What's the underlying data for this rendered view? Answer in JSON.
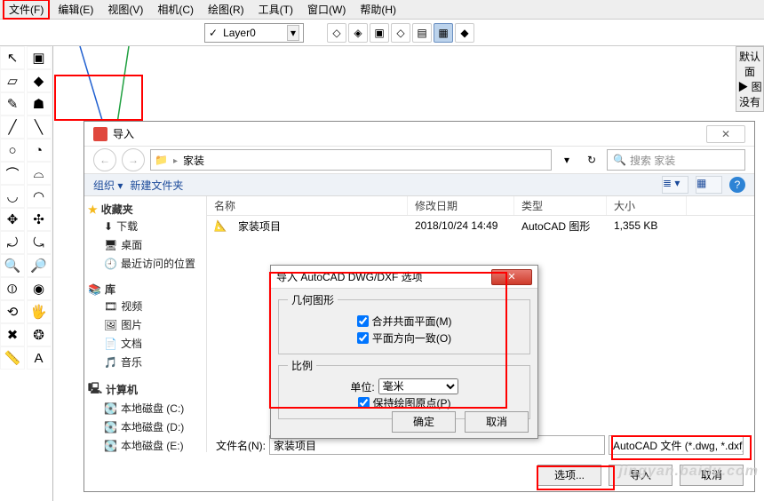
{
  "menu": {
    "items": [
      "文件(F)",
      "编辑(E)",
      "视图(V)",
      "相机(C)",
      "绘图(R)",
      "工具(T)",
      "窗口(W)",
      "帮助(H)"
    ]
  },
  "layer": {
    "check": "✓",
    "name": "Layer0"
  },
  "rightpanel": {
    "l1": "默认面",
    "l2": "▶ 图",
    "l3": "没有"
  },
  "leftToolbar": {
    "colA": [
      "↖",
      "▱",
      "✎",
      "╱",
      "○",
      "⌒",
      "◡",
      "✥",
      "⤾",
      "🔍",
      "⦶",
      "⟲",
      "✖",
      "📏"
    ],
    "colB": [
      "▣",
      "◆",
      "☗",
      "╲",
      "◔",
      "⌓",
      "◠",
      "✣",
      "⤿",
      "🔎",
      "◉",
      "🖐",
      "❂",
      "A"
    ]
  },
  "dlgImport": {
    "title": "导入",
    "path_root": "家装",
    "search_placeholder": "搜索 家装",
    "organize": "组织 ▾",
    "newfolder": "新建文件夹",
    "help": "?",
    "tree": {
      "fav": "收藏夹",
      "fav_items": [
        "下载",
        "桌面",
        "最近访问的位置"
      ],
      "lib": "库",
      "lib_items": [
        "视频",
        "图片",
        "文档",
        "音乐"
      ],
      "pc": "计算机",
      "pc_items": [
        "本地磁盘 (C:)",
        "本地磁盘 (D:)",
        "本地磁盘 (E:)"
      ]
    },
    "cols": [
      "名称",
      "修改日期",
      "类型",
      "大小"
    ],
    "rows": [
      {
        "name": "家装项目",
        "date": "2018/10/24 14:49",
        "type": "AutoCAD 图形",
        "size": "1,355 KB"
      }
    ],
    "fname_label": "文件名(N):",
    "fname_value": "家装项目",
    "ftype": "AutoCAD 文件 (*.dwg, *.dxf)",
    "btn_options": "选项...",
    "btn_import": "导入",
    "btn_cancel": "取消"
  },
  "dlgOpt": {
    "title": "导入 AutoCAD DWG/DXF 选项",
    "geom_group": "几何图形",
    "merge_faces": "合并共面平面(M)",
    "orient_faces": "平面方向一致(O)",
    "scale_group": "比例",
    "unit_label": "单位:",
    "unit_value": "毫米",
    "keep_origin": "保持绘图原点(P)",
    "ok": "确定",
    "cancel": "取消"
  },
  "watermark": "jingyan.baidu.com"
}
